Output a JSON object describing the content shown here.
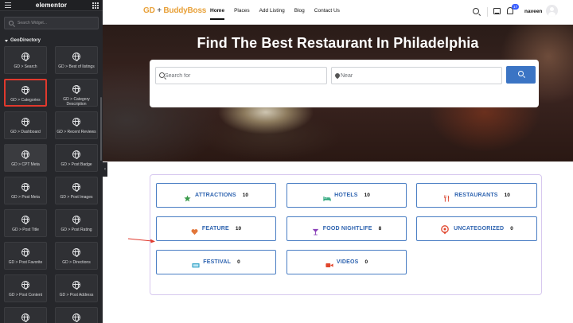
{
  "panel": {
    "logo": "elementor",
    "search_placeholder": "Search Widget...",
    "category_title": "GeoDirectory",
    "widgets": [
      {
        "label": "GD > Search",
        "highlight": false
      },
      {
        "label": "GD > Best of listings",
        "highlight": false
      },
      {
        "label": "GD > Categories",
        "highlight": true
      },
      {
        "label": "GD > Category Description",
        "highlight": false
      },
      {
        "label": "GD > Dashboard",
        "highlight": false
      },
      {
        "label": "GD > Recent Reviews",
        "highlight": false
      },
      {
        "label": "GD > CPT Meta",
        "highlight": false
      },
      {
        "label": "GD > Post Badge",
        "highlight": false
      },
      {
        "label": "GD > Post Meta",
        "highlight": false
      },
      {
        "label": "GD > Post Images",
        "highlight": false
      },
      {
        "label": "GD > Post Title",
        "highlight": false
      },
      {
        "label": "GD > Post Rating",
        "highlight": false
      },
      {
        "label": "GD > Post Favorite",
        "highlight": false
      },
      {
        "label": "GD > Directions",
        "highlight": false
      },
      {
        "label": "GD > Post Content",
        "highlight": false
      },
      {
        "label": "GD > Post Address",
        "highlight": false
      },
      {
        "label": "",
        "highlight": false
      },
      {
        "label": "",
        "highlight": false
      }
    ],
    "collapse_glyph": "‹"
  },
  "header": {
    "logo_left": "GD",
    "logo_plus": " + ",
    "logo_right": "BuddyBoss",
    "nav": [
      {
        "label": "Home",
        "active": true
      },
      {
        "label": "Places",
        "active": false
      },
      {
        "label": "Add Listing",
        "active": false
      },
      {
        "label": "Blog",
        "active": false
      },
      {
        "label": "Contact Us",
        "active": false
      }
    ],
    "notification_count": "17",
    "username": "naveen"
  },
  "hero": {
    "title": "Find The Best Restaurant In Philadelphia",
    "search_for_placeholder": "Search for",
    "near_placeholder": "Near"
  },
  "categories": [
    {
      "name": "ATTRACTIONS",
      "count": "10",
      "icon": "star-icon",
      "color": "#3a9b4b"
    },
    {
      "name": "HOTELS",
      "count": "10",
      "icon": "bed-icon",
      "color": "#2aa57a"
    },
    {
      "name": "RESTAURANTS",
      "count": "10",
      "icon": "utensils-icon",
      "color": "#d9452f"
    },
    {
      "name": "FEATURE",
      "count": "10",
      "icon": "heart-icon",
      "color": "#e2763a"
    },
    {
      "name": "FOOD NIGHTLIFE",
      "count": "8",
      "icon": "cocktail-icon",
      "color": "#8a3fb8"
    },
    {
      "name": "UNCATEGORIZED",
      "count": "0",
      "icon": "map-pin-icon",
      "color": "#e0452c"
    },
    {
      "name": "FESTIVAL",
      "count": "0",
      "icon": "ticket-icon",
      "color": "#3aa6c9"
    },
    {
      "name": "VIDEOS",
      "count": "0",
      "icon": "video-icon",
      "color": "#e0452c"
    }
  ],
  "colors": {
    "link": "#2f64b0",
    "border": "#4a7ec4",
    "search_button": "#3b74c4",
    "panel_bg": "#26272b",
    "highlight": "#e0392d"
  }
}
